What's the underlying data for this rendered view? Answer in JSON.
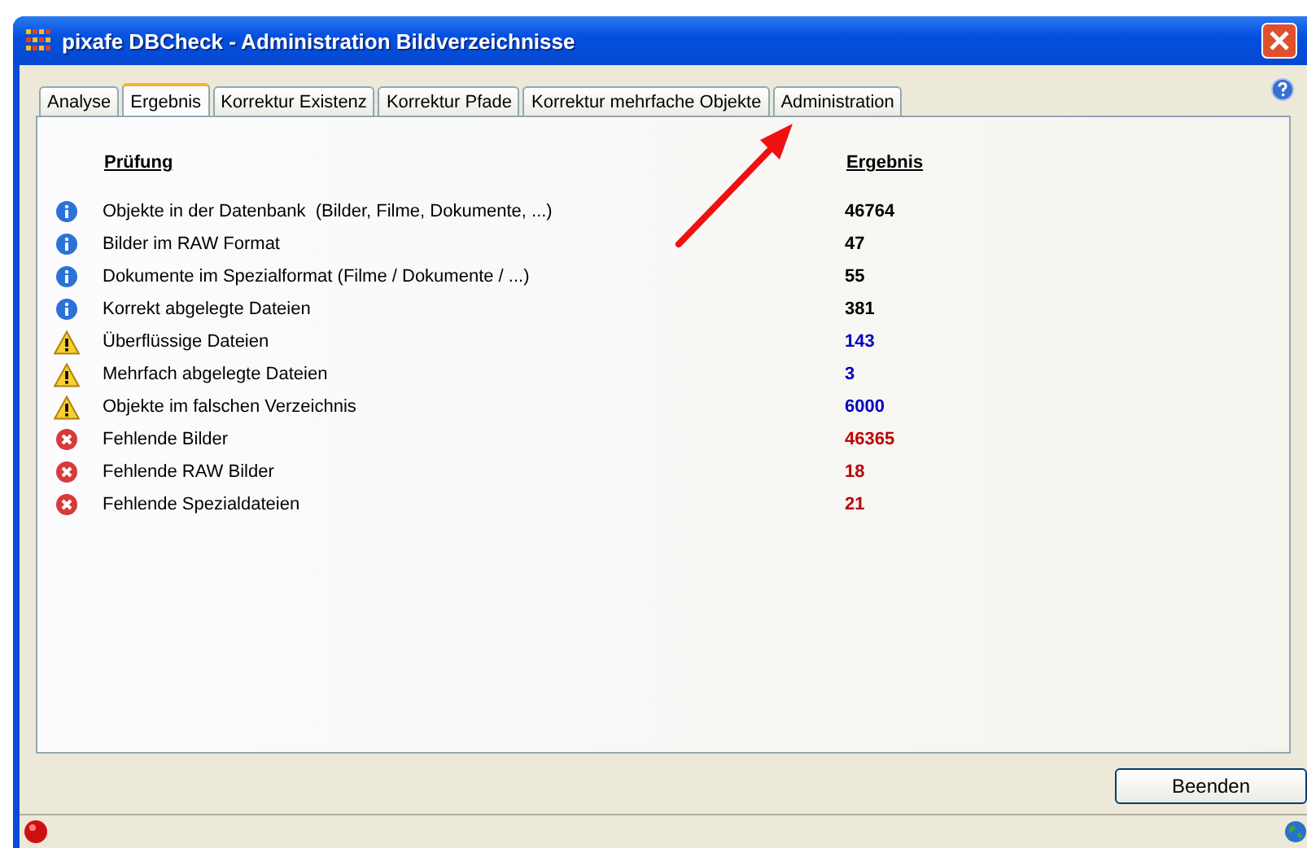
{
  "window": {
    "title": "pixafe DBCheck - Administration Bildverzeichnisse"
  },
  "tabs": [
    {
      "label": "Analyse",
      "selected": false
    },
    {
      "label": "Ergebnis",
      "selected": true
    },
    {
      "label": "Korrektur Existenz",
      "selected": false
    },
    {
      "label": "Korrektur Pfade",
      "selected": false
    },
    {
      "label": "Korrektur mehrfache Objekte",
      "selected": false
    },
    {
      "label": "Administration",
      "selected": false
    }
  ],
  "results": {
    "columns": [
      "Prüfung",
      "Ergebnis"
    ],
    "rows": [
      {
        "kind": "info",
        "label": "Objekte in der Datenbank  (Bilder, Filme, Dokumente, ...)",
        "value": "46764"
      },
      {
        "kind": "info",
        "label": "Bilder im RAW Format",
        "value": "47"
      },
      {
        "kind": "info",
        "label": "Dokumente im Spezialformat (Filme / Dokumente / ...)",
        "value": "55"
      },
      {
        "kind": "info",
        "label": "Korrekt abgelegte Dateien",
        "value": "381"
      },
      {
        "kind": "warning",
        "label": "Überflüssige Dateien",
        "value": "143"
      },
      {
        "kind": "warning",
        "label": "Mehrfach abgelegte Dateien",
        "value": "3"
      },
      {
        "kind": "warning",
        "label": "Objekte im falschen Verzeichnis",
        "value": "6000"
      },
      {
        "kind": "error",
        "label": "Fehlende Bilder",
        "value": "46365"
      },
      {
        "kind": "error",
        "label": "Fehlende RAW Bilder",
        "value": "18"
      },
      {
        "kind": "error",
        "label": "Fehlende Spezialdateien",
        "value": "21"
      }
    ]
  },
  "buttons": [
    "Beenden"
  ]
}
